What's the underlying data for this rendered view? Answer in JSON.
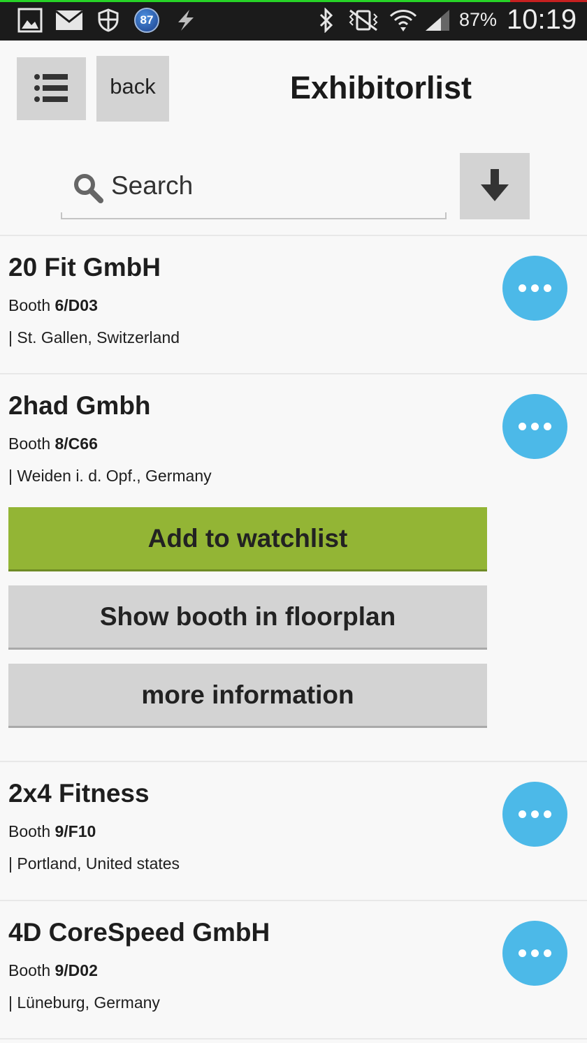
{
  "status_bar": {
    "badge_count": "87",
    "battery": "87%",
    "time": "10:19",
    "icons": [
      "gallery-icon",
      "mail-icon",
      "shield-icon",
      "badge-icon",
      "flash-icon",
      "bluetooth-icon",
      "vibrate-mute-icon",
      "wifi-icon",
      "signal-icon"
    ]
  },
  "header": {
    "back_label": "back",
    "title": "Exhibitorlist"
  },
  "search": {
    "placeholder": "Search"
  },
  "exhibitors": [
    {
      "name": "20 Fit GmbH",
      "booth_prefix": "Booth",
      "booth": "6/D03",
      "location": "| St. Gallen, Switzerland"
    },
    {
      "name": "2had Gmbh",
      "booth_prefix": "Booth",
      "booth": "8/C66",
      "location": "| Weiden i. d. Opf., Germany"
    },
    {
      "name": "2x4 Fitness",
      "booth_prefix": "Booth",
      "booth": "9/F10",
      "location": "| Portland, United states"
    },
    {
      "name": "4D CoreSpeed GmbH",
      "booth_prefix": "Booth",
      "booth": "9/D02",
      "location": "| Lüneburg, Germany"
    }
  ],
  "actions": {
    "watchlist": "Add to watchlist",
    "floorplan": "Show booth in floorplan",
    "more_info": "more information"
  },
  "colors": {
    "status_bar": "#1b1b1b",
    "button_gray": "#d3d3d3",
    "watchlist_green": "#93b535",
    "more_button_blue": "#4cb9e8",
    "background": "#f8f8f8"
  }
}
